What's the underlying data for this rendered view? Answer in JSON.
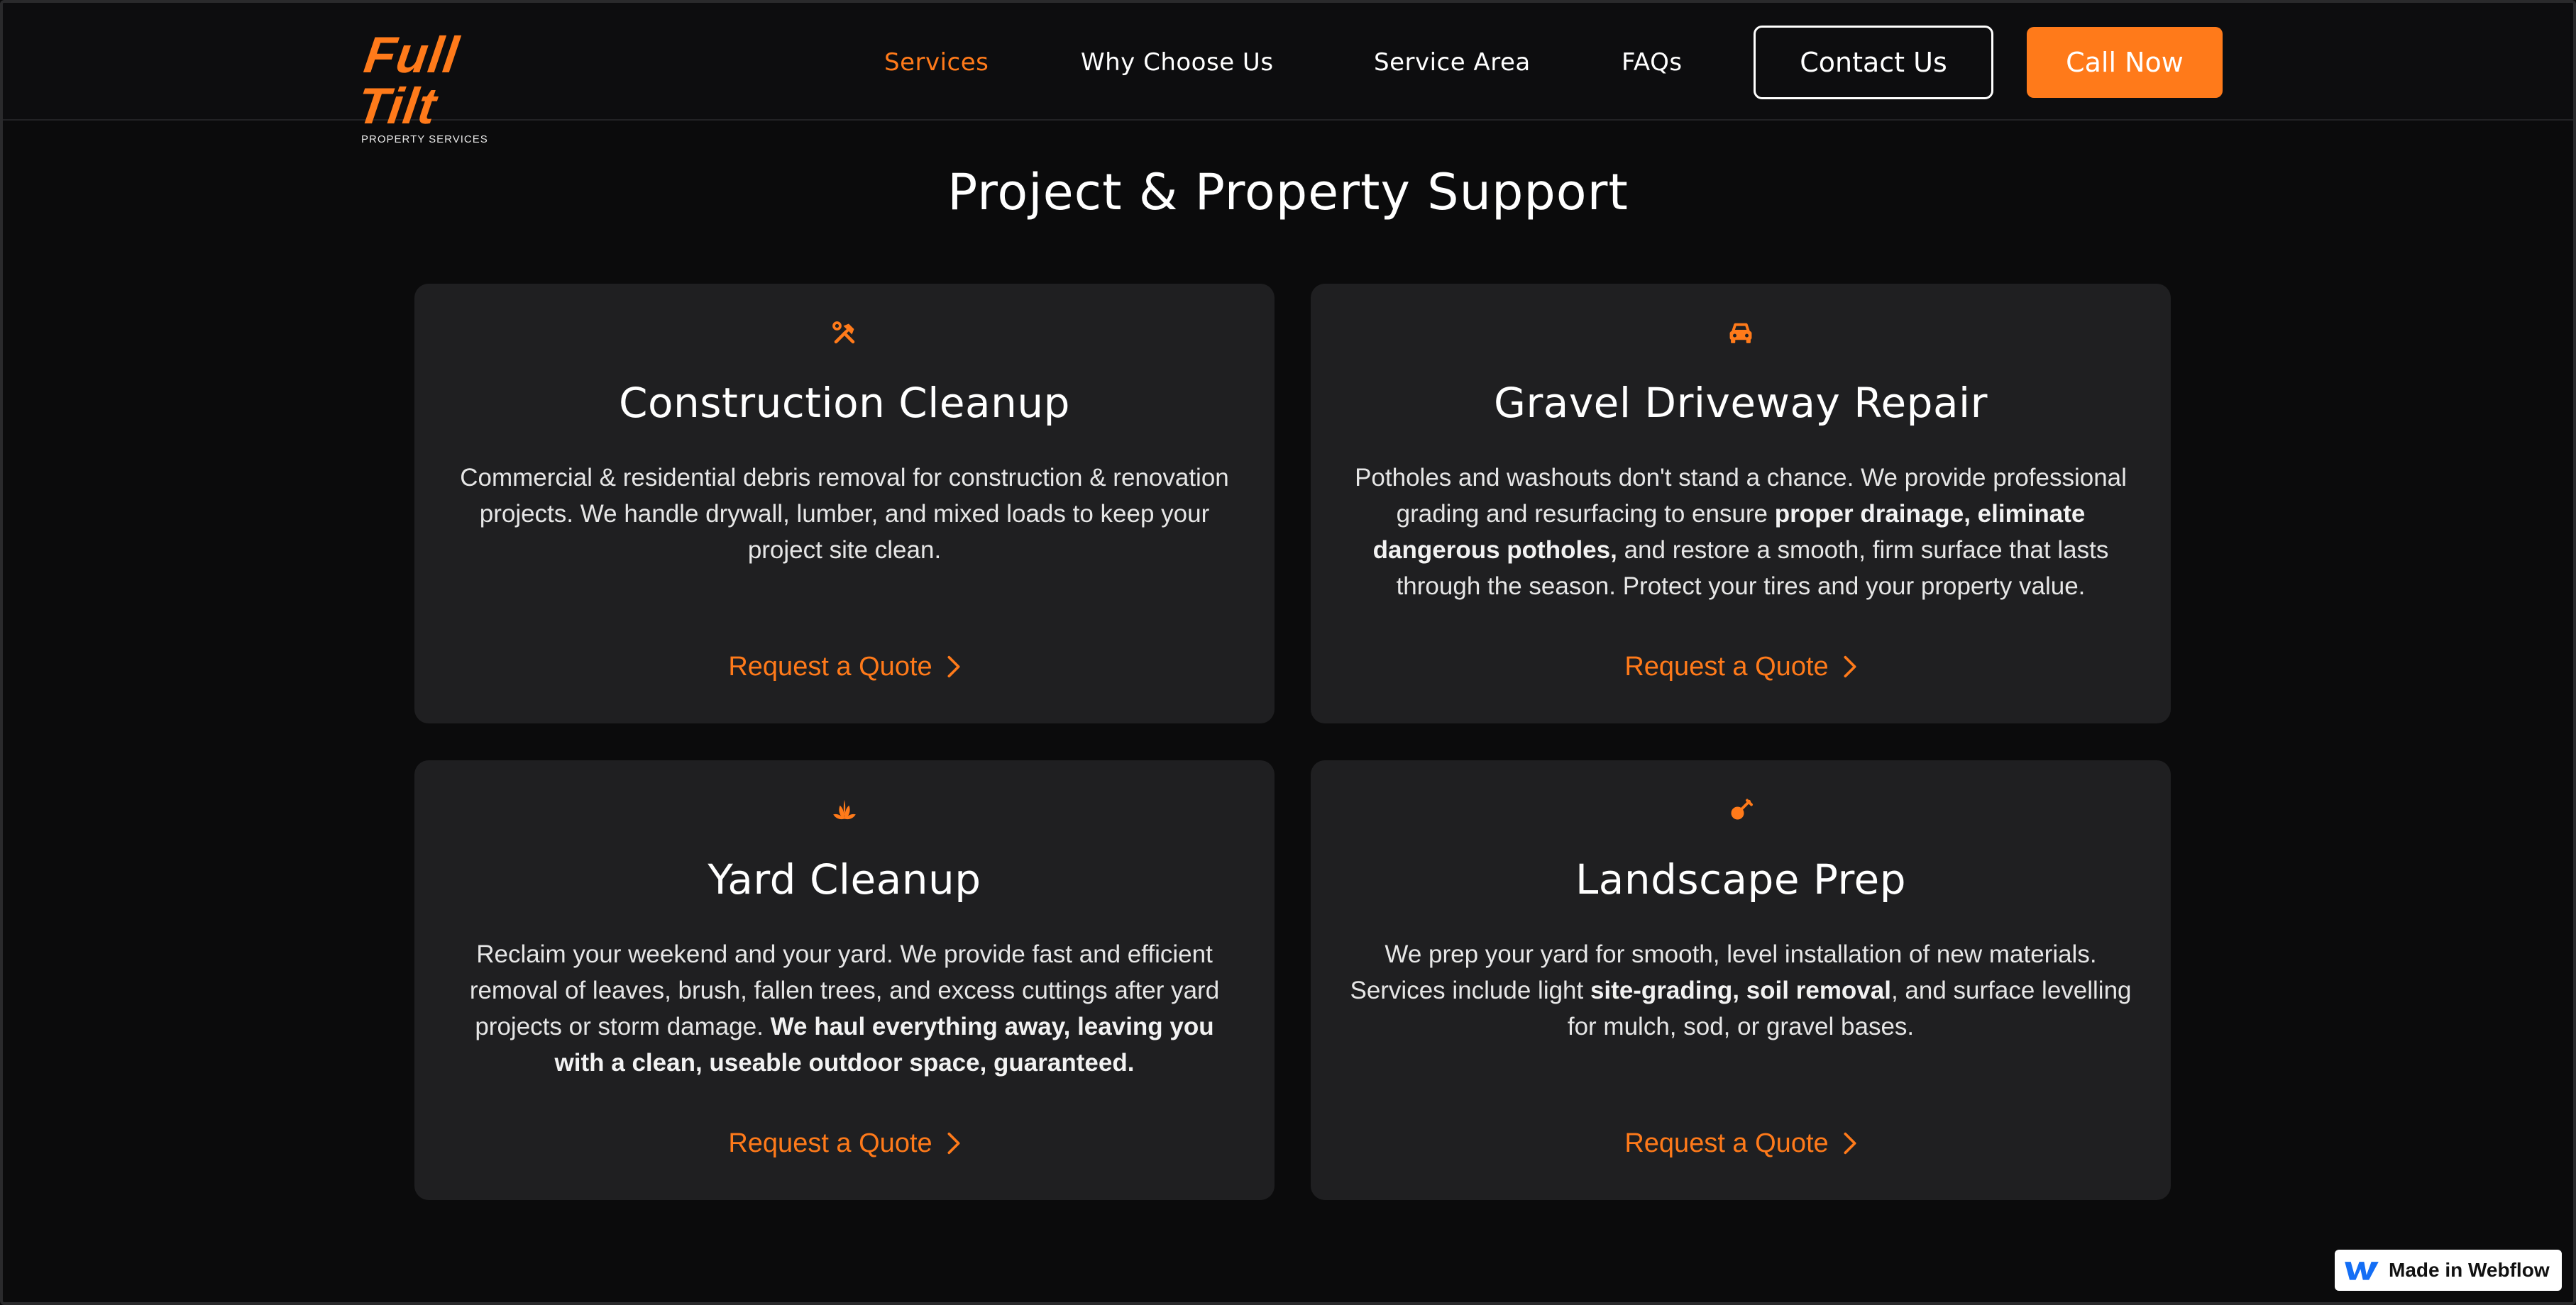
{
  "brand": {
    "logo_text": "Full Tilt",
    "logo_subtext": "PROPERTY SERVICES",
    "accent_color": "#ff7a1a"
  },
  "nav": {
    "links": [
      {
        "label": "Services",
        "active": true
      },
      {
        "label": "Why Choose Us",
        "active": false
      },
      {
        "label": "Service Area",
        "active": false
      },
      {
        "label": "FAQs",
        "active": false
      }
    ],
    "contact_label": "Contact Us",
    "call_label": "Call Now"
  },
  "section": {
    "title": "Project & Property Support"
  },
  "cards": [
    {
      "icon": "tools-icon",
      "title": "Construction Cleanup",
      "description_parts": [
        {
          "text": "Commercial & residential debris removal for construction & renovation projects. We handle drywall, lumber, and mixed loads to keep your project site clean.",
          "bold": false
        }
      ],
      "cta": "Request a Quote"
    },
    {
      "icon": "car-icon",
      "title": "Gravel Driveway Repair",
      "description_parts": [
        {
          "text": "Potholes and washouts don't stand a chance. We provide professional grading and resurfacing to ensure ",
          "bold": false
        },
        {
          "text": "proper drainage, eliminate dangerous potholes,",
          "bold": true
        },
        {
          "text": " and restore a smooth, firm surface that lasts through the season. Protect your tires and your property value.",
          "bold": false
        }
      ],
      "cta": "Request a Quote"
    },
    {
      "icon": "leaf-icon",
      "title": "Yard Cleanup",
      "description_parts": [
        {
          "text": "Reclaim your weekend and your yard. We provide fast and efficient removal of leaves, brush, fallen trees, and excess cuttings after yard projects or storm damage. ",
          "bold": false
        },
        {
          "text": "We haul everything away, leaving you with a clean, useable outdoor space, guaranteed.",
          "bold": true
        }
      ],
      "cta": "Request a Quote"
    },
    {
      "icon": "shovel-icon",
      "title": "Landscape Prep",
      "description_parts": [
        {
          "text": "We prep your yard for smooth, level installation of new materials. Services include light ",
          "bold": false
        },
        {
          "text": "site-grading, soil removal",
          "bold": true
        },
        {
          "text": ", and surface levelling for mulch, sod, or gravel bases.",
          "bold": false
        }
      ],
      "cta": "Request a Quote"
    }
  ],
  "webflow_badge": {
    "label": "Made in Webflow"
  }
}
